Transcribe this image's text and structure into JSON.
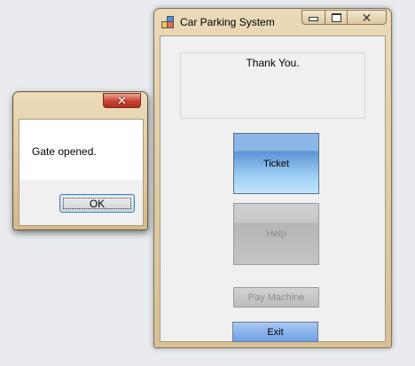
{
  "main_window": {
    "title": "Car Parking System",
    "icon": "app-window-icon",
    "message": "Thank You.",
    "buttons": {
      "ticket": "Ticket",
      "help": "Help",
      "pay_machine": "Pay Machine",
      "exit": "Exit"
    },
    "disabled": [
      "help",
      "pay_machine"
    ]
  },
  "dialog": {
    "message": "Gate opened.",
    "ok_label": "OK"
  },
  "colors": {
    "frame": "#d9c49b",
    "ticket_blue": "#5d94d6",
    "exit_blue": "#6fa0e4",
    "close_red": "#c9412f"
  }
}
